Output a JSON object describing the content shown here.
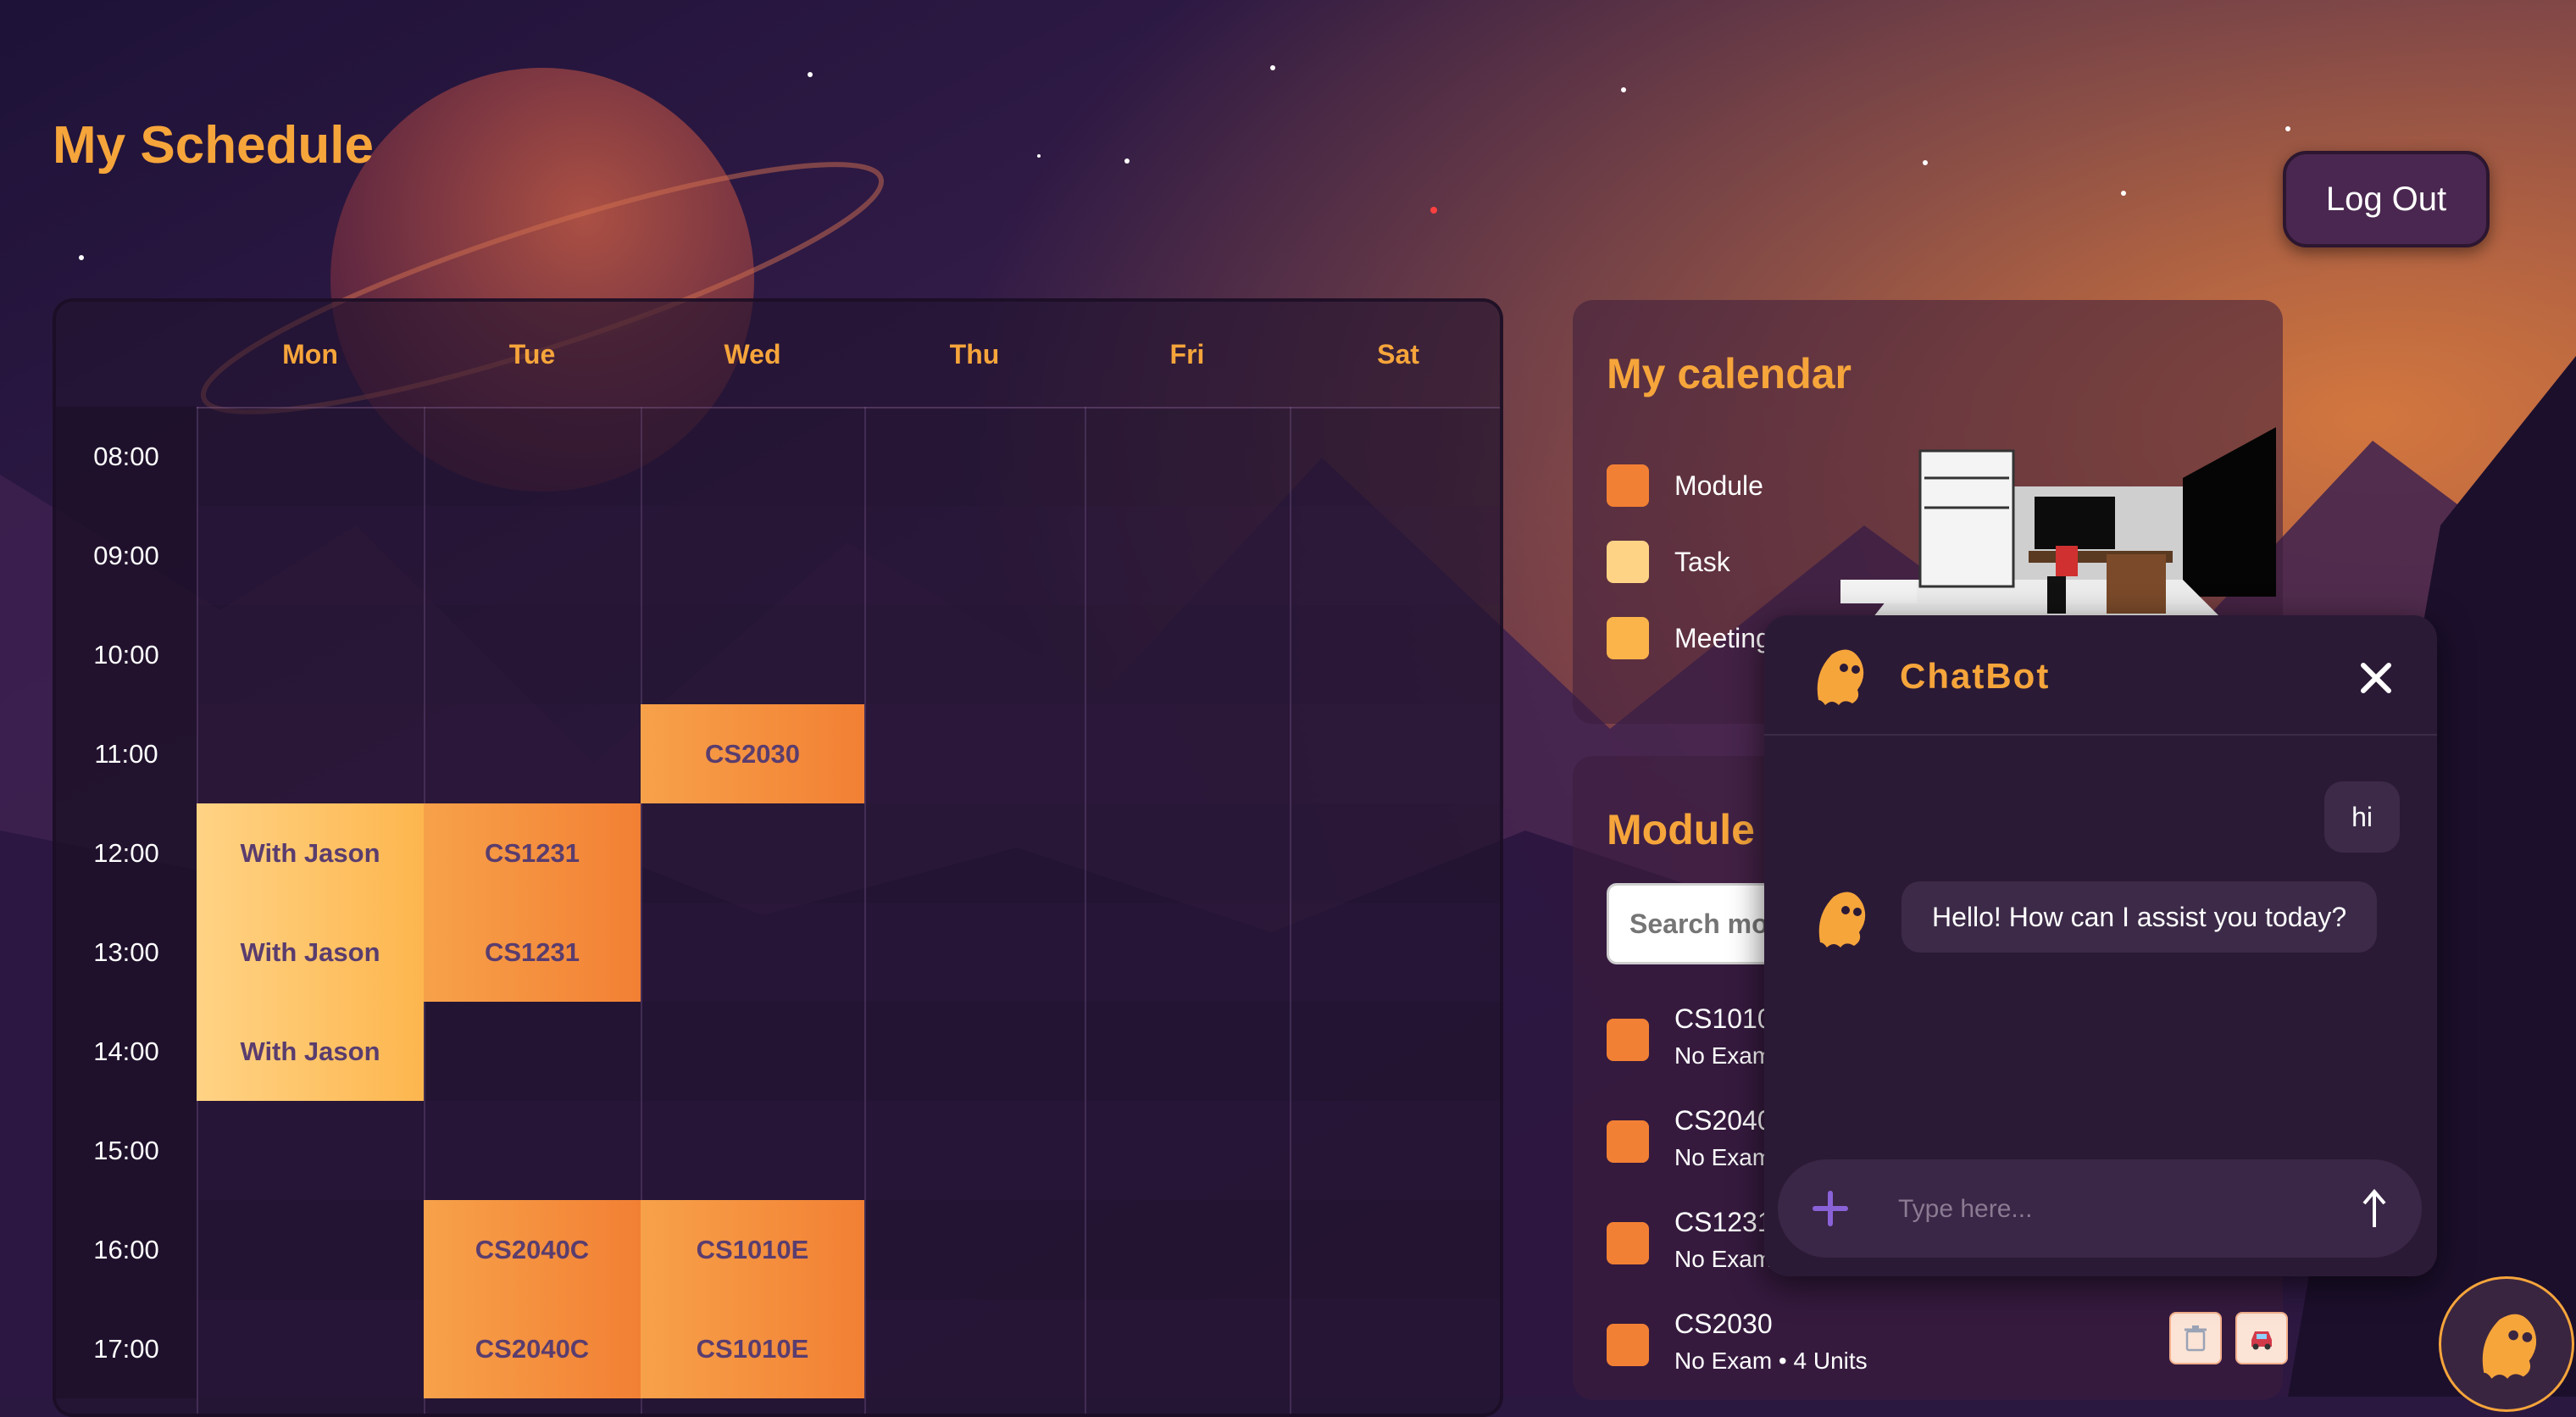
{
  "page": {
    "title": "My Schedule",
    "logout_label": "Log Out"
  },
  "schedule": {
    "days": [
      "Mon",
      "Tue",
      "Wed",
      "Thu",
      "Fri",
      "Sat"
    ],
    "times": [
      "08:00",
      "09:00",
      "10:00",
      "11:00",
      "12:00",
      "13:00",
      "14:00",
      "15:00",
      "16:00",
      "17:00"
    ],
    "events": [
      {
        "label": "CS2030",
        "day": "Wed",
        "time": "11:00",
        "type": "module"
      },
      {
        "label": "With Jason",
        "day": "Mon",
        "time": "12:00",
        "type": "task"
      },
      {
        "label": "With Jason",
        "day": "Mon",
        "time": "13:00",
        "type": "task"
      },
      {
        "label": "With Jason",
        "day": "Mon",
        "time": "14:00",
        "type": "task"
      },
      {
        "label": "CS1231",
        "day": "Tue",
        "time": "12:00",
        "type": "module"
      },
      {
        "label": "CS1231",
        "day": "Tue",
        "time": "13:00",
        "type": "module"
      },
      {
        "label": "CS2040C",
        "day": "Tue",
        "time": "16:00",
        "type": "module"
      },
      {
        "label": "CS2040C",
        "day": "Tue",
        "time": "17:00",
        "type": "module"
      },
      {
        "label": "CS1010E",
        "day": "Wed",
        "time": "16:00",
        "type": "module"
      },
      {
        "label": "CS1010E",
        "day": "Wed",
        "time": "17:00",
        "type": "module"
      }
    ]
  },
  "calendar": {
    "title": "My calendar",
    "legend": [
      {
        "label": "Module",
        "color": "#f28034"
      },
      {
        "label": "Task",
        "color": "#ffd385"
      },
      {
        "label": "Meeting",
        "color": "#fbb44a"
      }
    ]
  },
  "modules": {
    "title": "Module",
    "search_placeholder": "Search modules",
    "items": [
      {
        "code": "CS1010E",
        "meta": "No Exam • 4 Units"
      },
      {
        "code": "CS2040C",
        "meta": "No Exam • 4 Units"
      },
      {
        "code": "CS1231",
        "meta": "No Exam • 4 Units"
      },
      {
        "code": "CS2030",
        "meta": "No Exam • 4 Units"
      }
    ]
  },
  "chatbot": {
    "title": "ChatBot",
    "messages": [
      {
        "from": "user",
        "text": "hi"
      },
      {
        "from": "bot",
        "text": "Hello! How can I assist you today?"
      }
    ],
    "input_placeholder": "Type here..."
  },
  "colors": {
    "accent": "#f6a53b",
    "module": "#f28034",
    "task": "#ffd385",
    "meeting": "#fbb44a"
  },
  "icons": [
    "ghost-icon",
    "close-icon",
    "plus-icon",
    "send-arrow-icon",
    "trash-icon",
    "car-icon"
  ]
}
